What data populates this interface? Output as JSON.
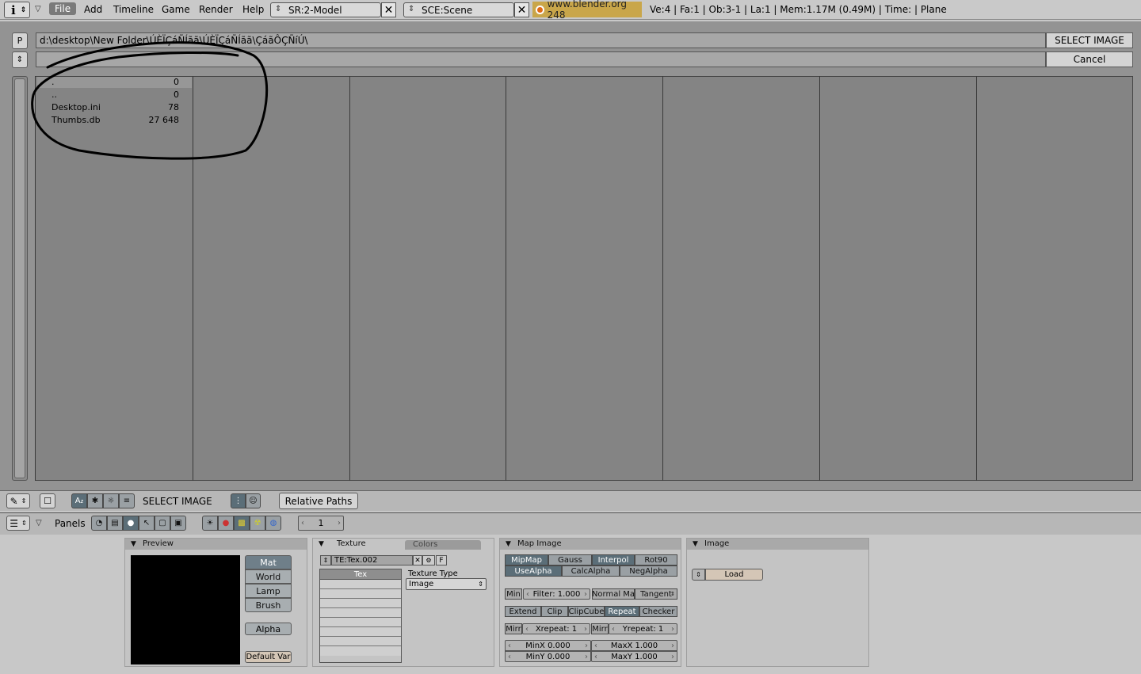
{
  "topbar": {
    "menus": [
      "File",
      "Add",
      "Timeline",
      "Game",
      "Render",
      "Help"
    ],
    "screen": "SR:2-Model",
    "scene": "SCE:Scene",
    "website": "www.blender.org 248",
    "stats": "Ve:4 | Fa:1 | Ob:3-1 | La:1  | Mem:1.17M (0.49M)  | Time: | Plane"
  },
  "filebrowser": {
    "parent_button": "P",
    "path": "d:\\desktop\\New Folder\\ÚÈÏÇáÑÍãã\\ÚÈÏÇáÑÍãã\\ÇáãÔÇÑíÚ\\",
    "select_button": "SELECT IMAGE",
    "filename": "",
    "cancel_button": "Cancel",
    "files": [
      {
        "name": ".",
        "size": "0"
      },
      {
        "name": "..",
        "size": "0"
      },
      {
        "name": "Desktop.ini",
        "size": "78"
      },
      {
        "name": "Thumbs.db",
        "size": "27 648"
      }
    ]
  },
  "filefooter": {
    "title": "SELECT IMAGE",
    "relative_paths": "Relative Paths"
  },
  "buttonsheader": {
    "panels_label": "Panels",
    "frame": "1"
  },
  "preview": {
    "title": "Preview",
    "buttons": [
      "Mat",
      "World",
      "Lamp",
      "Brush"
    ],
    "alpha": "Alpha",
    "default_var": "Default Var"
  },
  "texture": {
    "tab_texture": "Texture",
    "tab_colors": "Colors",
    "name": "TE:Tex.002",
    "f_label": "F",
    "tex_label": "Tex",
    "type_label": "Texture Type",
    "type_value": "Image"
  },
  "mapimage": {
    "title": "Map Image",
    "row1": [
      "MipMap",
      "Gauss",
      "Interpol",
      "Rot90"
    ],
    "row2": [
      "UseAlpha",
      "CalcAlpha",
      "NegAlpha"
    ],
    "min": "Min",
    "filter": "Filter: 1.000",
    "normalmap": "Normal Ma",
    "tangent": "Tangent",
    "extend_row": [
      "Extend",
      "Clip",
      "ClipCube",
      "Repeat",
      "Checker"
    ],
    "mirr": "Mirr",
    "xrepeat": "Xrepeat: 1",
    "yrepeat": "Yrepeat: 1",
    "minx": "MinX 0.000",
    "maxx": "MaxX 1.000",
    "miny": "MinY 0.000",
    "maxy": "MaxY 1.000"
  },
  "image": {
    "title": "Image",
    "load": "Load"
  }
}
